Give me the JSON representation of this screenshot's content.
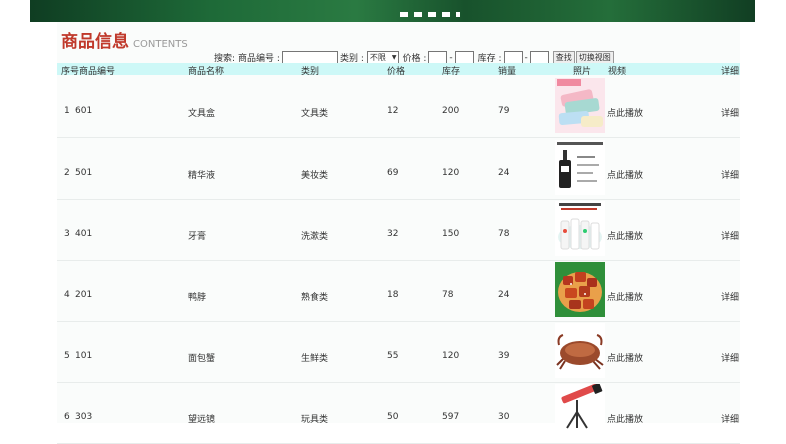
{
  "page": {
    "title": "商品信息",
    "subtitle": "CONTENTS"
  },
  "search": {
    "label_search": "搜索:",
    "label_product_no": "商品编号 :",
    "label_category": "类别 :",
    "category_value": "不限",
    "label_price": "价格 :",
    "label_stock": "库存 :",
    "dash": "-",
    "find_button": "查找",
    "switch_view_button": "切换视图"
  },
  "table": {
    "headers": {
      "seq_no": "序号商品编号",
      "name": "商品名称",
      "category": "类别",
      "price": "价格",
      "stock": "库存",
      "sales": "销量",
      "photo": "照片",
      "video": "视频",
      "detail": "详细"
    },
    "rows": [
      {
        "seq": "1",
        "no": "601",
        "name": "文具盒",
        "category": "文具类",
        "price": "12",
        "stock": "200",
        "sales": "79",
        "video": "点此播放",
        "detail": "详细"
      },
      {
        "seq": "2",
        "no": "501",
        "name": "精华液",
        "category": "美妆类",
        "price": "69",
        "stock": "120",
        "sales": "24",
        "video": "点此播放",
        "detail": "详细"
      },
      {
        "seq": "3",
        "no": "401",
        "name": "牙膏",
        "category": "洗漱类",
        "price": "32",
        "stock": "150",
        "sales": "78",
        "video": "点此播放",
        "detail": "详细"
      },
      {
        "seq": "4",
        "no": "201",
        "name": "鸭脖",
        "category": "熟食类",
        "price": "18",
        "stock": "78",
        "sales": "24",
        "video": "点此播放",
        "detail": "详细"
      },
      {
        "seq": "5",
        "no": "101",
        "name": "面包蟹",
        "category": "生鲜类",
        "price": "55",
        "stock": "120",
        "sales": "39",
        "video": "点此播放",
        "detail": "详细"
      },
      {
        "seq": "6",
        "no": "303",
        "name": "望远镜",
        "category": "玩具类",
        "price": "50",
        "stock": "597",
        "sales": "30",
        "video": "点此播放",
        "detail": "详细"
      }
    ]
  },
  "colors": {
    "title": "#c0392b",
    "header_bg": "#cdf8f7",
    "banner": "#1e6a38"
  },
  "icons": [
    "pencil-case-photo",
    "serum-photo",
    "toothpaste-photo",
    "duck-neck-photo",
    "crab-photo",
    "telescope-photo"
  ]
}
